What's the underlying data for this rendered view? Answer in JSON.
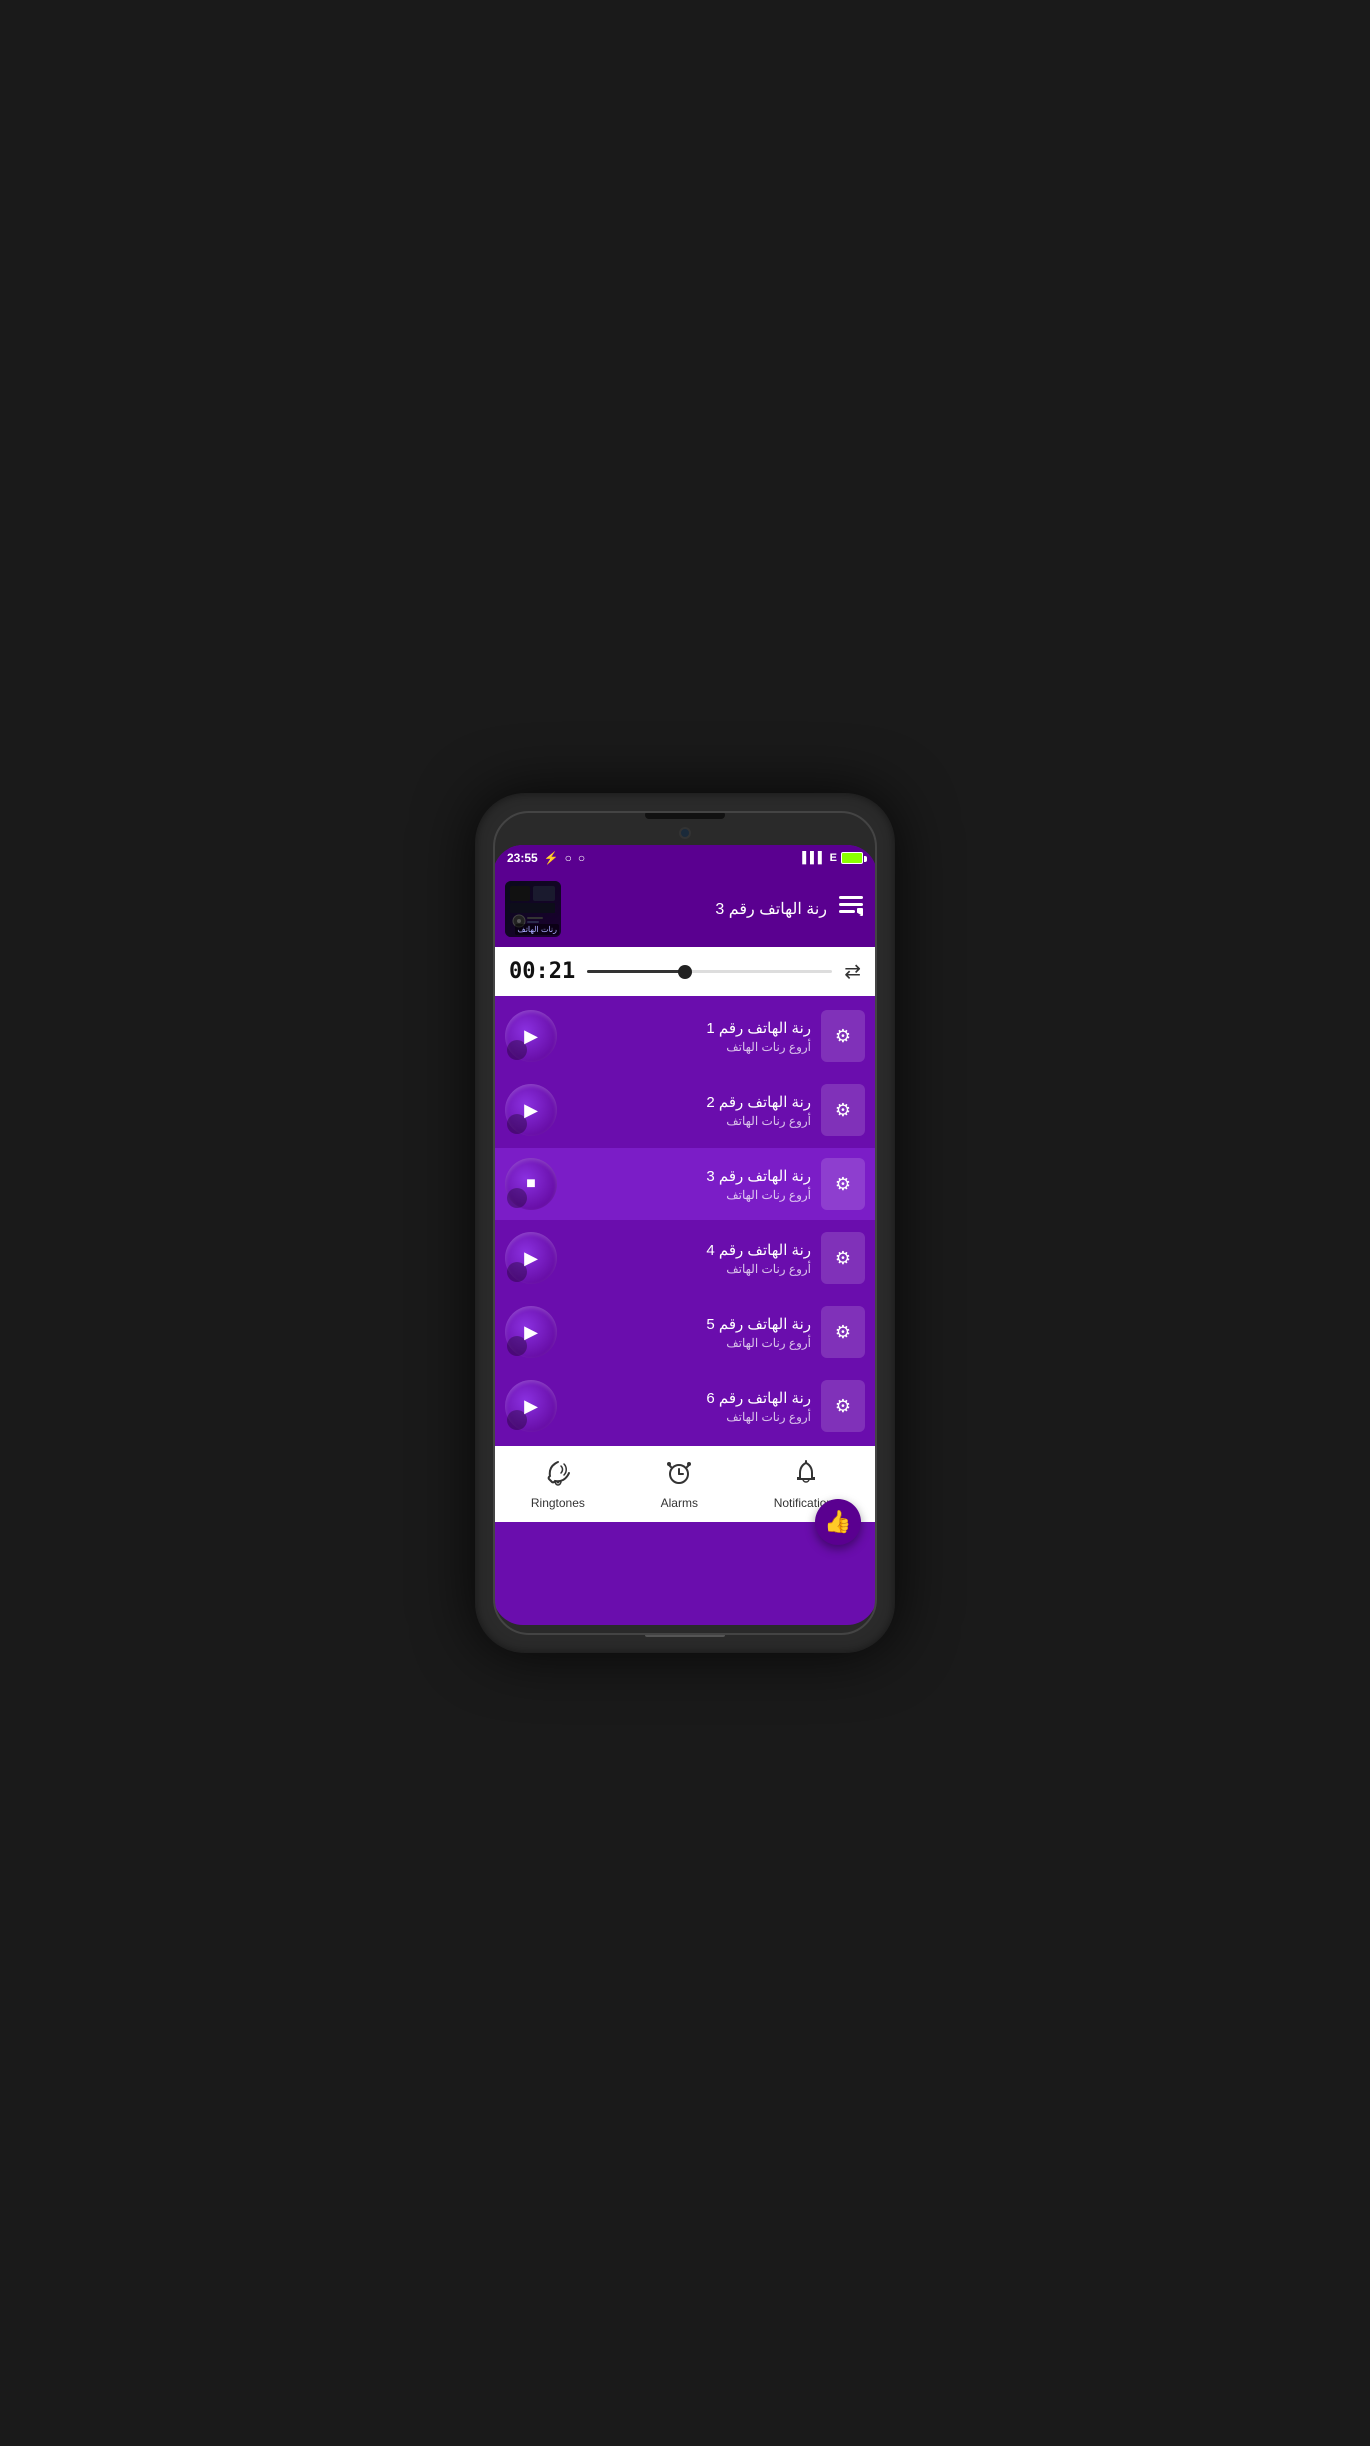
{
  "statusBar": {
    "time": "23:55",
    "batteryLabel": "E"
  },
  "nowPlaying": {
    "title": "رنة الهاتف رقم 3",
    "albumArtText": "رنات الهاتف"
  },
  "player": {
    "time": "00:21",
    "progress": 40
  },
  "songs": [
    {
      "id": 1,
      "title": "رنة الهاتف رقم 1",
      "subtitle": "أروع رنات الهاتف",
      "active": false,
      "playing": false
    },
    {
      "id": 2,
      "title": "رنة الهاتف رقم 2",
      "subtitle": "أروع رنات الهاتف",
      "active": false,
      "playing": false
    },
    {
      "id": 3,
      "title": "رنة الهاتف رقم 3",
      "subtitle": "أروع رنات الهاتف",
      "active": true,
      "playing": true
    },
    {
      "id": 4,
      "title": "رنة الهاتف رقم 4",
      "subtitle": "أروع رنات الهاتف",
      "active": false,
      "playing": false
    },
    {
      "id": 5,
      "title": "رنة الهاتف رقم 5",
      "subtitle": "أروع رنات الهاتف",
      "active": false,
      "playing": false
    },
    {
      "id": 6,
      "title": "رنة الهاتف رقم 6",
      "subtitle": "أروع رنات الهاتف",
      "active": false,
      "playing": false
    }
  ],
  "bottomNav": {
    "ringtones": "Ringtones",
    "alarms": "Alarms",
    "notifications": "Notifications"
  },
  "icons": {
    "play": "▶",
    "stop": "■",
    "settings": "⚙",
    "queue": "≡",
    "repeat": "⇄",
    "ringtone": "📳",
    "alarm": "⏰",
    "notification": "🔔",
    "thumbUp": "👍"
  }
}
